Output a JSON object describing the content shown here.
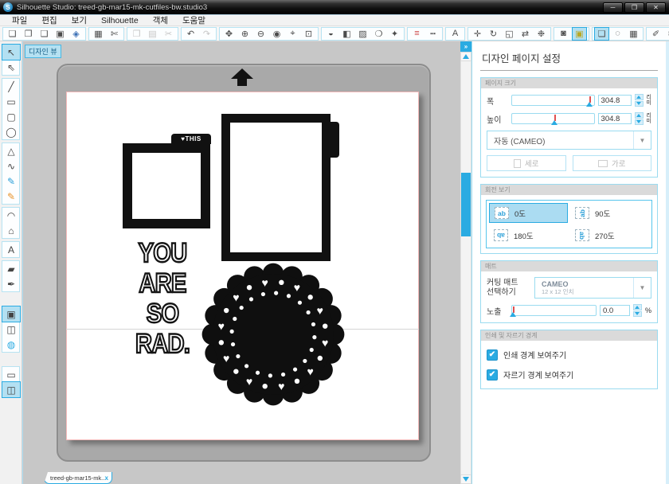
{
  "window": {
    "title": "Silhouette Studio: treed-gb-mar15-mk-cutfiles-bw.studio3",
    "logo": "S",
    "controls": [
      {
        "name": "minimize-button",
        "glyph": "─"
      },
      {
        "name": "maximize-button",
        "glyph": "❐"
      },
      {
        "name": "close-button",
        "glyph": "✕"
      }
    ]
  },
  "menu": {
    "items": [
      "파일",
      "편집",
      "보기",
      "Silhouette",
      "객체",
      "도움말"
    ]
  },
  "toolbar": {
    "left_groups": [
      [
        {
          "name": "new-document-icon",
          "glyph": "❏"
        },
        {
          "name": "open-file-icon",
          "glyph": "❐"
        },
        {
          "name": "open-library-icon",
          "glyph": "❑"
        },
        {
          "name": "save-icon",
          "glyph": "▣"
        },
        {
          "name": "save-to-library-icon",
          "glyph": "◈",
          "color": "#3a6fb5"
        }
      ],
      [
        {
          "name": "print-icon",
          "glyph": "▦"
        },
        {
          "name": "send-to-silhouette-icon",
          "glyph": "✄"
        }
      ],
      [
        {
          "name": "copy-icon",
          "glyph": "❒",
          "disabled": true
        },
        {
          "name": "paste-icon",
          "glyph": "▤",
          "disabled": true
        },
        {
          "name": "cut-icon",
          "glyph": "✂",
          "disabled": true
        }
      ],
      [
        {
          "name": "undo-icon",
          "glyph": "↶"
        },
        {
          "name": "redo-icon",
          "glyph": "↷",
          "disabled": true
        }
      ],
      [
        {
          "name": "pan-icon",
          "glyph": "✥"
        },
        {
          "name": "zoom-in-icon",
          "glyph": "⊕"
        },
        {
          "name": "zoom-out-icon",
          "glyph": "⊖"
        },
        {
          "name": "zoom-selection-icon",
          "glyph": "◉"
        },
        {
          "name": "drag-zoom-icon",
          "glyph": "⌖"
        },
        {
          "name": "fit-to-page-icon",
          "glyph": "⊡"
        }
      ]
    ],
    "right_groups": [
      [
        {
          "name": "fill-color-icon",
          "glyph": "◒"
        },
        {
          "name": "fill-gradient-icon",
          "glyph": "◧"
        },
        {
          "name": "fill-pattern-icon",
          "glyph": "▨"
        },
        {
          "name": "trace-icon",
          "glyph": "❍"
        },
        {
          "name": "offset-icon",
          "glyph": "✦"
        }
      ],
      [
        {
          "name": "line-color-icon",
          "glyph": "≡",
          "color": "#cc4444"
        },
        {
          "name": "line-style-icon",
          "glyph": "┅"
        }
      ],
      [
        {
          "name": "text-style-icon",
          "glyph": "A"
        }
      ],
      [
        {
          "name": "move-icon",
          "glyph": "✛"
        },
        {
          "name": "rotate-icon",
          "glyph": "↻"
        },
        {
          "name": "scale-icon",
          "glyph": "◱"
        },
        {
          "name": "mirror-icon",
          "glyph": "⇄"
        },
        {
          "name": "modify-icon",
          "glyph": "❉"
        }
      ],
      [
        {
          "name": "pixscan-icon",
          "glyph": "◙"
        },
        {
          "name": "design-emblem-icon",
          "glyph": "▣",
          "color": "#b8a826",
          "active": true
        }
      ],
      [
        {
          "name": "design-page-settings-icon",
          "glyph": "❏",
          "active": true
        },
        {
          "name": "registration-marks-icon",
          "glyph": "◌"
        },
        {
          "name": "grid-settings-icon",
          "glyph": "▦"
        }
      ],
      [
        {
          "name": "eraser-icon",
          "glyph": "✐"
        },
        {
          "name": "cutter-icon",
          "glyph": "✄"
        }
      ]
    ]
  },
  "tools": {
    "groups": [
      [
        {
          "name": "select-tool",
          "glyph": "↖",
          "active": true
        },
        {
          "name": "point-edit-tool",
          "glyph": "⇖"
        }
      ],
      [
        {
          "name": "line-tool",
          "glyph": "╱"
        },
        {
          "name": "rectangle-tool",
          "glyph": "▭"
        },
        {
          "name": "rounded-rectangle-tool",
          "glyph": "▢"
        },
        {
          "name": "ellipse-tool",
          "glyph": "◯"
        }
      ],
      [
        {
          "name": "polygon-tool",
          "glyph": "△"
        },
        {
          "name": "curve-tool",
          "glyph": "∿"
        },
        {
          "name": "draw-tool",
          "glyph": "✎",
          "color": "#2a9fd8"
        },
        {
          "name": "smooth-draw-tool",
          "glyph": "✎",
          "color": "#e8922a"
        }
      ],
      [
        {
          "name": "arc-tool",
          "glyph": "◠"
        },
        {
          "name": "regular-polygon-tool",
          "glyph": "⌂"
        }
      ],
      [
        {
          "name": "text-tool",
          "glyph": "A"
        }
      ],
      [
        {
          "name": "eraser-tool",
          "glyph": "▰"
        },
        {
          "name": "knife-tool",
          "glyph": "✒"
        }
      ],
      null,
      [
        {
          "name": "pixscan-view",
          "glyph": "▣",
          "active": true
        },
        {
          "name": "trace-view",
          "glyph": "◫"
        },
        {
          "name": "store-view",
          "glyph": "◍",
          "color": "#2aabe2"
        }
      ],
      null,
      [
        {
          "name": "layout-single-view",
          "glyph": "▭"
        },
        {
          "name": "layout-panels-view",
          "glyph": "◫",
          "active": true
        }
      ]
    ]
  },
  "canvas": {
    "badge": "디자인 뷰",
    "frame_small_tab": "♥THIS",
    "text_lines": [
      "YOU",
      "ARE",
      "SO",
      "RAD."
    ],
    "doc_tab": {
      "label": "treed-gb-mar15-mk...",
      "close": "x"
    }
  },
  "panel": {
    "collapse": "»",
    "title": "디자인 페이지 설정",
    "page_size": {
      "section": "페이지 크기",
      "rows": [
        {
          "label": "폭",
          "value": "304.8",
          "pos": 0.96
        },
        {
          "label": "높이",
          "value": "304.8",
          "pos": 0.53
        }
      ],
      "unit": [
        "리",
        "미"
      ],
      "preset": "자동 (CAMEO)",
      "orientation": [
        {
          "label": "세로"
        },
        {
          "label": "가로"
        }
      ]
    },
    "rotate": {
      "section": "회전 보기",
      "icon_text": "ab",
      "options": [
        {
          "label": "0도",
          "rot": 0,
          "selected": true
        },
        {
          "label": "90도",
          "rot": -90,
          "selected": false
        },
        {
          "label": "180도",
          "rot": 180,
          "selected": false
        },
        {
          "label": "270도",
          "rot": 90,
          "selected": false
        }
      ]
    },
    "mat": {
      "section": "매트",
      "label_line1": "커팅 매트",
      "label_line2": "선택하기",
      "name": "CAMEO",
      "size": "12 x 12 인치",
      "reveal_label": "노출",
      "reveal_value": "0.0",
      "reveal_pos": 0.02,
      "reveal_unit": "%"
    },
    "borders": {
      "section": "인쇄 및 자르기 경계",
      "options": [
        "인쇄 경계 보여주기",
        "자르기 경계 보여주기"
      ]
    }
  },
  "colors": {
    "accent": "#2aabe2",
    "selection_bg": "#b3e0f2",
    "mat_gray": "#a9a9a9",
    "page_border_pink": "#f3b9b9",
    "ink": "#111111"
  }
}
